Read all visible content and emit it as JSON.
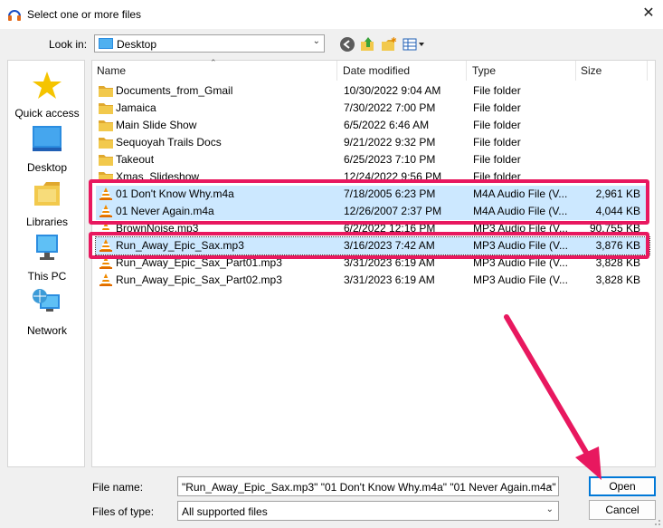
{
  "window": {
    "title": "Select one or more files",
    "close_label": "✕",
    "icon": "audacity-icon"
  },
  "lookin": {
    "label": "Look in:",
    "value": "Desktop"
  },
  "toolbar": {
    "icons": [
      "back-icon",
      "up-folder-icon",
      "new-folder-icon",
      "view-menu-icon"
    ]
  },
  "places": [
    {
      "label": "Quick access",
      "icon": "star-icon"
    },
    {
      "label": "Desktop",
      "icon": "desktop-icon"
    },
    {
      "label": "Libraries",
      "icon": "libraries-icon"
    },
    {
      "label": "This PC",
      "icon": "computer-icon"
    },
    {
      "label": "Network",
      "icon": "network-icon"
    }
  ],
  "columns": {
    "name": "Name",
    "date": "Date modified",
    "type": "Type",
    "size": "Size"
  },
  "files": [
    {
      "name": "Documents_from_Gmail",
      "date": "10/30/2022 9:04 AM",
      "type": "File folder",
      "size": "",
      "icon": "folder-icon",
      "state": ""
    },
    {
      "name": "Jamaica",
      "date": "7/30/2022 7:00 PM",
      "type": "File folder",
      "size": "",
      "icon": "folder-icon",
      "state": ""
    },
    {
      "name": "Main Slide Show",
      "date": "6/5/2022 6:46 AM",
      "type": "File folder",
      "size": "",
      "icon": "folder-icon",
      "state": ""
    },
    {
      "name": "Sequoyah Trails Docs",
      "date": "9/21/2022 9:32 PM",
      "type": "File folder",
      "size": "",
      "icon": "folder-icon",
      "state": ""
    },
    {
      "name": "Takeout",
      "date": "6/25/2023 7:10 PM",
      "type": "File folder",
      "size": "",
      "icon": "folder-icon",
      "state": ""
    },
    {
      "name": "Xmas_Slideshow",
      "date": "12/24/2022 9:56 PM",
      "type": "File folder",
      "size": "",
      "icon": "folder-icon",
      "state": ""
    },
    {
      "name": "01 Don't Know Why.m4a",
      "date": "7/18/2005 6:23 PM",
      "type": "M4A Audio File (V...",
      "size": "2,961 KB",
      "icon": "vlc-icon",
      "state": "selected"
    },
    {
      "name": "01 Never Again.m4a",
      "date": "12/26/2007 2:37 PM",
      "type": "M4A Audio File (V...",
      "size": "4,044 KB",
      "icon": "vlc-icon",
      "state": "selected"
    },
    {
      "name": "BrownNoise.mp3",
      "date": "6/2/2022 12:16 PM",
      "type": "MP3 Audio File (V...",
      "size": "90,755 KB",
      "icon": "vlc-icon",
      "state": ""
    },
    {
      "name": "Run_Away_Epic_Sax.mp3",
      "date": "3/16/2023 7:42 AM",
      "type": "MP3 Audio File (V...",
      "size": "3,876 KB",
      "icon": "vlc-icon",
      "state": "focused"
    },
    {
      "name": "Run_Away_Epic_Sax_Part01.mp3",
      "date": "3/31/2023 6:19 AM",
      "type": "MP3 Audio File (V...",
      "size": "3,828 KB",
      "icon": "vlc-icon",
      "state": ""
    },
    {
      "name": "Run_Away_Epic_Sax_Part02.mp3",
      "date": "3/31/2023 6:19 AM",
      "type": "MP3 Audio File (V...",
      "size": "3,828 KB",
      "icon": "vlc-icon",
      "state": ""
    }
  ],
  "filename": {
    "label": "File name:",
    "value": "\"Run_Away_Epic_Sax.mp3\" \"01 Don't Know Why.m4a\" \"01 Never Again.m4a\""
  },
  "filetype": {
    "label": "Files of type:",
    "value": "All supported files"
  },
  "buttons": {
    "open": "Open",
    "cancel": "Cancel"
  },
  "colors": {
    "highlight": "#e8185f",
    "selection": "#cce8ff",
    "accent": "#0078d7"
  }
}
